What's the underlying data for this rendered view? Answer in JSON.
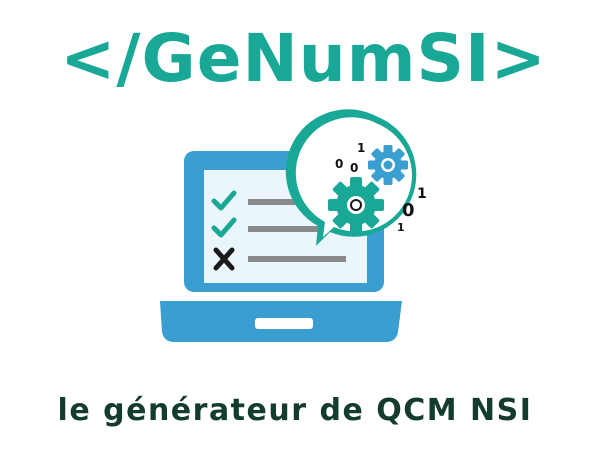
{
  "logo": {
    "title": "</GeNumSI>"
  },
  "tagline": "le générateur de QCM NSI",
  "bubble": {
    "binary_digits": [
      "1",
      "0",
      "0",
      "1",
      "0",
      "1"
    ]
  },
  "colors": {
    "brand_teal": "#1aa896",
    "laptop_blue": "#3a9ed0",
    "screen_light": "#eaf6fc",
    "tagline_dark": "#133b30",
    "check_teal": "#1aa896",
    "cross_dark": "#1a1a1a",
    "list_line_gray": "#8a8a8a",
    "gear_teal": "#1aa896",
    "gear_blue": "#3a9ed0"
  },
  "icons": {
    "check": "check-icon",
    "cross": "cross-icon",
    "gear_large": "gear-icon",
    "gear_small": "gear-icon"
  }
}
